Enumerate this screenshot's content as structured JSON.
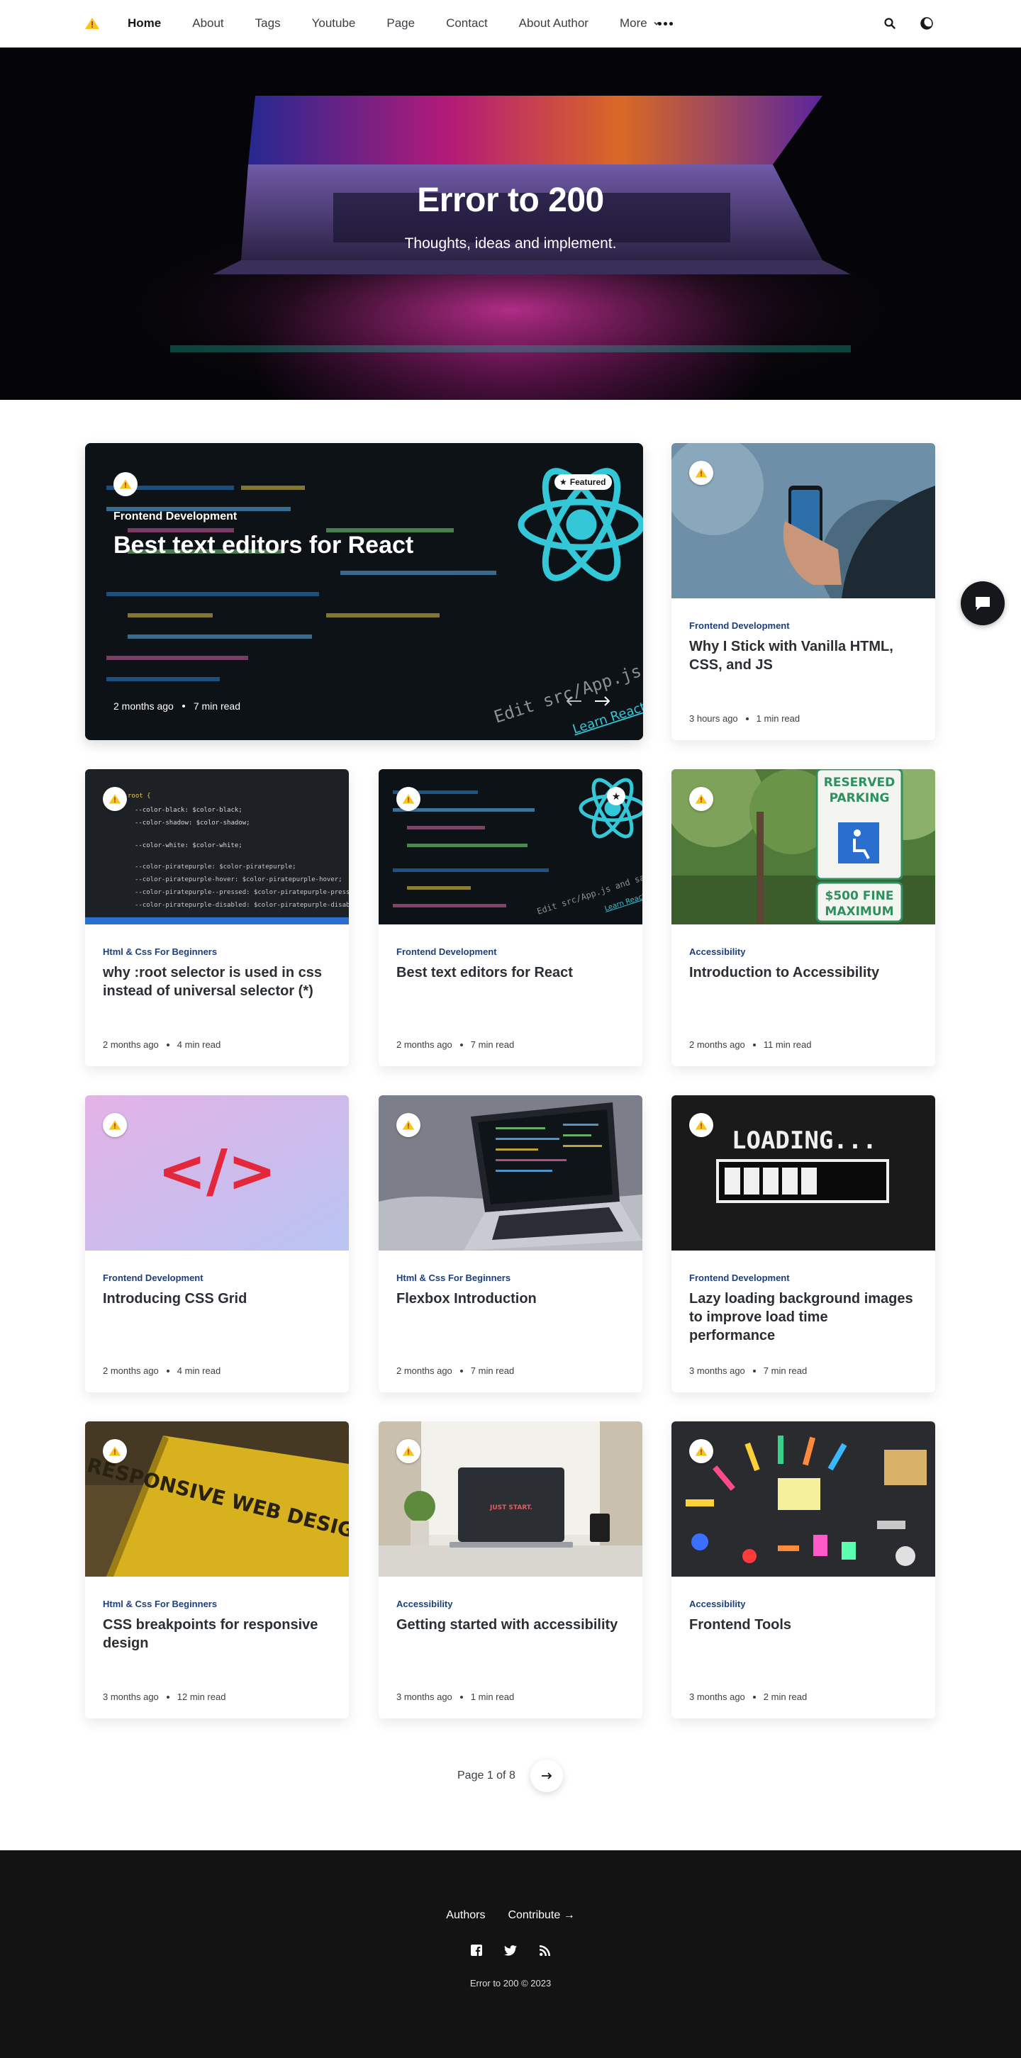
{
  "nav": {
    "links": [
      "Home",
      "About",
      "Tags",
      "Youtube",
      "Page",
      "Contact",
      "About Author"
    ],
    "more_label": "More",
    "icons": [
      "warning-logo-icon",
      "more-dots-icon",
      "search-icon",
      "moon-icon"
    ]
  },
  "hero": {
    "title": "Error to 200",
    "subtitle": "Thoughts, ideas and implement."
  },
  "featured": {
    "badge": "Featured",
    "tag": "Frontend Development",
    "title": "Best text editors for React",
    "date": "2 months ago",
    "read": "7 min read",
    "image_text": "Edit src/App.js and save to",
    "image_link": "Learn React"
  },
  "posts": [
    {
      "tag": "Frontend Development",
      "title": "Why I Stick with Vanilla HTML, CSS, and JS",
      "date": "3 hours ago",
      "read": "1 min read"
    },
    {
      "tag": "Html & Css For Beginners",
      "title": "why :root selector is used in css instead of universal selector (*)",
      "date": "2 months ago",
      "read": "4 min read"
    },
    {
      "tag": "Frontend Development",
      "title": "Best text editors for React",
      "date": "2 months ago",
      "read": "7 min read"
    },
    {
      "tag": "Accessibility",
      "title": "Introduction to Accessibility",
      "date": "2 months ago",
      "read": "11 min read"
    },
    {
      "tag": "Frontend Development",
      "title": "Introducing CSS Grid",
      "date": "2 months ago",
      "read": "4 min read"
    },
    {
      "tag": "Html & Css For Beginners",
      "title": "Flexbox Introduction",
      "date": "2 months ago",
      "read": "7 min read"
    },
    {
      "tag": "Frontend Development",
      "title": "Lazy loading background images to improve load time performance",
      "date": "3 months ago",
      "read": "7 min read"
    },
    {
      "tag": "Html & Css For Beginners",
      "title": "CSS breakpoints for responsive design",
      "date": "3 months ago",
      "read": "12 min read"
    },
    {
      "tag": "Accessibility",
      "title": "Getting started with accessibility",
      "date": "3 months ago",
      "read": "1 min read"
    },
    {
      "tag": "Accessibility",
      "title": "Frontend Tools",
      "date": "3 months ago",
      "read": "2 min read"
    }
  ],
  "image_text": {
    "code_lines": [
      "root {",
      "--color-black: $color-black;",
      "--color-shadow: $color-shadow;",
      "--color-white: $color-white;",
      "--color-piratepurple: $color-piratepurple;",
      "--color-piratepurple-hover: $color-piratepurple-hover;",
      "--color-piratepurple--pressed: $color-piratepurple-pressed;",
      "--color-piratepurple-disabled: $color-piratepurple-disabled;"
    ],
    "sign_top": "RESERVED",
    "sign_mid": "PARKING",
    "sign_fine": "$500 FINE",
    "sign_max": "MAXIMUM",
    "code_symbol": "</>",
    "loading": "LOADING...",
    "book_title": "RESPONSIVE WEB DESIGN",
    "laptop_text": "JUST START."
  },
  "pagination": {
    "label": "Page 1 of 8"
  },
  "footer": {
    "links": [
      "Authors",
      "Contribute →"
    ],
    "social": [
      "facebook-icon",
      "twitter-icon",
      "rss-icon"
    ],
    "copyright": "Error to 200 © 2023"
  },
  "colors": {
    "accent": "#1e3f7a",
    "footer_bg": "#131313",
    "logo_yellow": "#f5c518"
  }
}
